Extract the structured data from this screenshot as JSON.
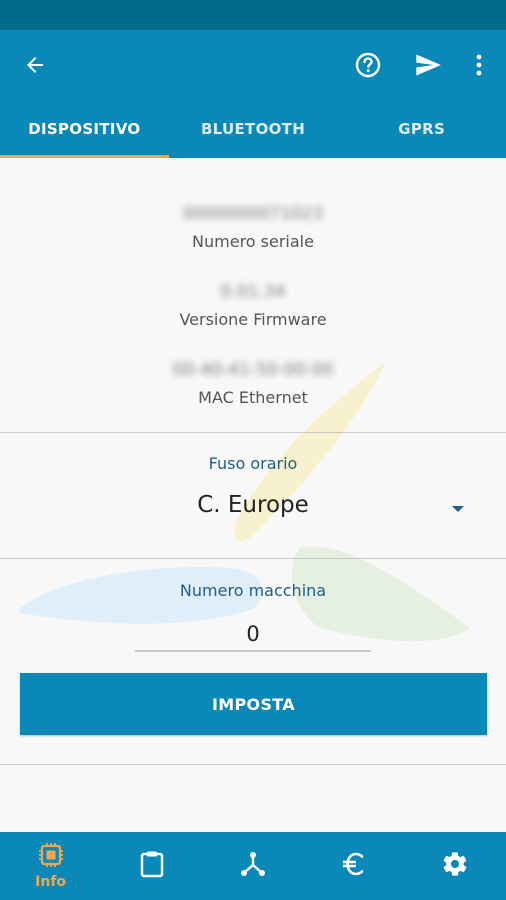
{
  "colors": {
    "primary": "#0a89b8",
    "status_bar": "#006a8a",
    "accent": "#f3a64f",
    "label_blue": "#1f5f86"
  },
  "app_bar": {
    "icons": [
      "back-arrow-icon",
      "help-icon",
      "send-icon",
      "more-vert-icon"
    ]
  },
  "tabs": [
    {
      "label": "DISPOSITIVO",
      "active": true
    },
    {
      "label": "BLUETOOTH",
      "active": false
    },
    {
      "label": "GPRS",
      "active": false
    }
  ],
  "device_info": {
    "serial": {
      "value": "0000000071023",
      "label": "Numero seriale"
    },
    "firmware": {
      "value": "0.01.34",
      "label": "Versione Firmware"
    },
    "mac": {
      "value": "00-40-41-50-00-00",
      "label": "MAC Ethernet"
    }
  },
  "timezone": {
    "label": "Fuso orario",
    "value": "C. Europe"
  },
  "machine_number": {
    "label": "Numero macchina",
    "value": "0"
  },
  "set_button": {
    "label": "IMPOSTA"
  },
  "bottom_nav": [
    {
      "icon": "chip-icon",
      "label": "Info",
      "active": true
    },
    {
      "icon": "clipboard-icon",
      "label": "",
      "active": false
    },
    {
      "icon": "network-icon",
      "label": "",
      "active": false
    },
    {
      "icon": "euro-icon",
      "label": "",
      "active": false
    },
    {
      "icon": "gear-icon",
      "label": "",
      "active": false
    }
  ]
}
